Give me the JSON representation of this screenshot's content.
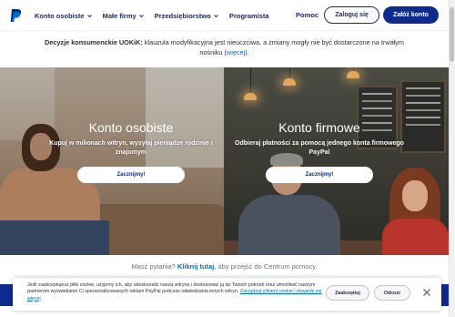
{
  "header": {
    "nav": [
      {
        "label": "Konto osobiste",
        "has_dropdown": true
      },
      {
        "label": "Małe firmy",
        "has_dropdown": true
      },
      {
        "label": "Przedsiębiorstwo",
        "has_dropdown": true
      },
      {
        "label": "Programista",
        "has_dropdown": false
      }
    ],
    "help_label": "Pomoc",
    "login_label": "Zaloguj się",
    "signup_label": "Załóż konto"
  },
  "notice": {
    "title": "Decyzje konsumenckie UOKiK:",
    "text": " klauzula modyfikacyjna jest nieuczciwa, a zmiany mogły nie być dostarczone na trwałym nośniku (",
    "link": "więcej",
    "end": ")."
  },
  "hero": {
    "personal": {
      "title": "Konto osobiste",
      "subtitle": "Kupuj w milionach witryn, wysyłaj pieniądze rodzinie i znajomym",
      "cta": "Zacznijmy!"
    },
    "business": {
      "title": "Konto firmowe",
      "subtitle": "Odbieraj płatności za pomocą jednego konta firmowego PayPal",
      "cta": "Zacznijmy!"
    }
  },
  "questions": {
    "before": "Masz pytania? ",
    "link": "Kliknij tutaj",
    "after": ", aby przejść do Centrum pomocy."
  },
  "cookie": {
    "text": "Jeśli zaakceptujesz pliki cookie, użyjemy ich, aby udoskonalić naszą witrynę i dostosować ją do Twoich potrzeb oraz umożliwić naszym partnerom wyświetlanie Ci spersonalizowanych reklam PayPal podczas odwiedzania innych witryn.",
    "link": "Zarządzaj plikami cookie i dowiedz się więcej",
    "accept_label": "Zaakceptuj",
    "reject_label": "Odrzuć"
  },
  "colors": {
    "brand_navy": "#0d2a8f",
    "nav_text": "#1c2b62",
    "link_blue": "#0070ba"
  },
  "icons": {
    "logo": "paypal-logo-icon",
    "dropdown": "chevron-down-icon",
    "close": "close-icon"
  }
}
